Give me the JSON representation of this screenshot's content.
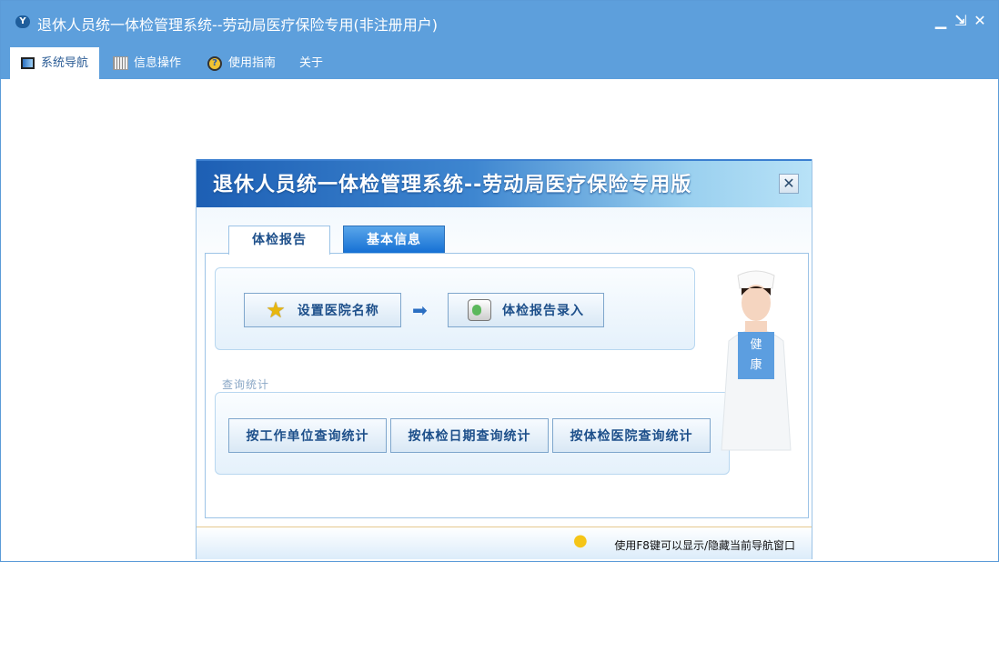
{
  "window": {
    "title": "退休人员统一体检管理系统--劳动局医疗保险专用(非注册用户)",
    "app_icon": "Y",
    "minimize": "▁",
    "restore": "⇲",
    "close": "✕"
  },
  "menu": [
    {
      "label": "系统导航",
      "icon": "monitor-icon"
    },
    {
      "label": "信息操作",
      "icon": "grid-icon"
    },
    {
      "label": "使用指南",
      "icon": "help-icon"
    },
    {
      "label": "关于"
    }
  ],
  "panel": {
    "title": "退休人员统一体检管理系统--劳动局医疗保险专用版",
    "close": "✕",
    "tabs": [
      "体检报告",
      "基本信息"
    ],
    "report": {
      "set_hospital": "设置医院名称",
      "arrow": "➡",
      "report_entry": "体检报告录入"
    },
    "query_label": "查询统计",
    "query_buttons": [
      "按工作单位查询统计",
      "按体检日期查询统计",
      "按体检医院查询统计"
    ],
    "sign": [
      "健",
      "康"
    ],
    "hint": "使用F8键可以显示/隐藏当前导航窗口"
  }
}
